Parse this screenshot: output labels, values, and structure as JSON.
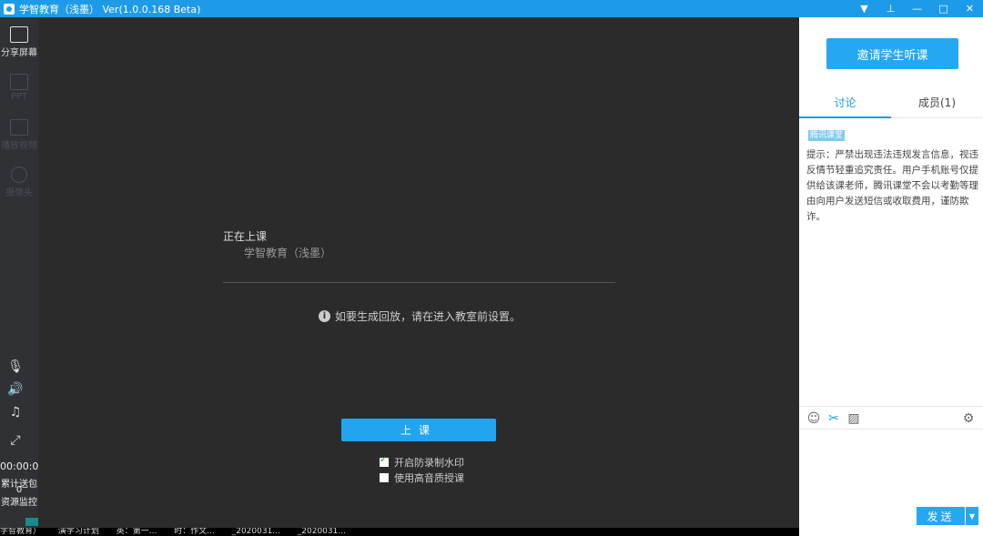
{
  "window": {
    "title": "学智教育（浅墨） Ver(1.0.0.168 Beta)",
    "controls": [
      {
        "name": "menu-dropdown",
        "icon": "triangle-down-icon",
        "glyph": "▼"
      },
      {
        "name": "pin",
        "icon": "pin-icon",
        "glyph": "⊥"
      },
      {
        "name": "minimize",
        "icon": "minimize-icon",
        "glyph": "—"
      },
      {
        "name": "maximize",
        "icon": "maximize-icon",
        "glyph": "□"
      },
      {
        "name": "close",
        "icon": "close-icon",
        "glyph": "✕"
      }
    ]
  },
  "toolbar": {
    "tools": [
      {
        "label": "分享屏幕",
        "icon": "share-screen-icon",
        "state": "active"
      },
      {
        "label": "PPT",
        "icon": "ppt-icon",
        "state": "disabled"
      },
      {
        "label": "播放视频",
        "icon": "play-video-icon",
        "state": "disabled"
      },
      {
        "label": "摄像头",
        "icon": "camera-icon",
        "state": "disabled"
      }
    ],
    "controls": [
      {
        "name": "mic-muted",
        "icon": "mic-muted-icon",
        "glyph": "🎙"
      },
      {
        "name": "speaker",
        "icon": "speaker-icon",
        "glyph": "🔊"
      },
      {
        "name": "music",
        "icon": "music-icon",
        "glyph": "♫"
      },
      {
        "name": "fullscreen",
        "icon": "fullscreen-icon",
        "glyph": "⤢"
      }
    ],
    "timer": "00:00:00",
    "gift_label": "累计送包",
    "gift_count": "0",
    "monitor_label": "资源监控"
  },
  "stage": {
    "status_label": "正在上课",
    "class_name": "学智教育（浅墨）",
    "hint": "如要生成回放，请在进入教室前设置。",
    "start_button": "上课",
    "options": [
      {
        "label": "开启防录制水印",
        "checked": true
      },
      {
        "label": "使用高音质授课",
        "checked": false
      }
    ]
  },
  "taskbar": {
    "items": [
      "学智教育）",
      "演学习计划",
      "英：第一...",
      "时：作文...",
      "_2020031...",
      "_2020031..."
    ]
  },
  "panel": {
    "invite_button": "邀请学生听课",
    "tabs": [
      {
        "label": "讨论",
        "active": true
      },
      {
        "label": "成员(1)",
        "active": false
      }
    ],
    "badge": "腾讯课堂",
    "notice": "提示：严禁出现违法违规发言信息，视违反情节轻重追究责任。用户手机账号仅提供给该课老师，腾讯课堂不会以考勤等理由向用户发送短信或收取费用，谨防欺诈。",
    "compose_icons": [
      {
        "name": "emoji",
        "icon": "emoji-icon",
        "glyph": "☺"
      },
      {
        "name": "scissors",
        "icon": "scissors-icon",
        "glyph": "✂"
      },
      {
        "name": "image",
        "icon": "image-icon",
        "glyph": "▨"
      },
      {
        "name": "settings",
        "icon": "gear-icon",
        "glyph": "⚙"
      }
    ],
    "send_button": "发送",
    "send_dropdown": "▼"
  },
  "colors": {
    "accent": "#1e9be8",
    "button": "#23a4ee",
    "stage_bg": "#2b2b2b",
    "toolbar_bg": "#2f3135"
  }
}
